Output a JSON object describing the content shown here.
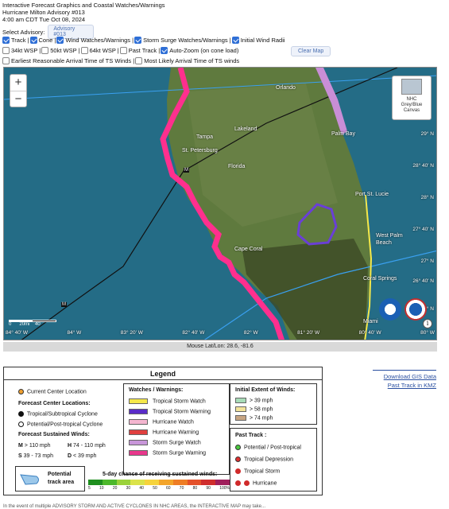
{
  "header": {
    "line1": "Interactive Forecast Graphics and Coastal Watches/Warnings",
    "line2": "Hurricane Milton Advisory #013",
    "line3": "4:00 am CDT Tue Oct 08, 2024"
  },
  "advisory": {
    "label": "Select Advisory:",
    "value": "Advisory #013"
  },
  "options_row1": [
    {
      "label": "Track |",
      "checked": true
    },
    {
      "label": "Cone |",
      "checked": true
    },
    {
      "label": "Wind Watches/Warnings |",
      "checked": true
    },
    {
      "label": "Storm Surge Watches/Warnings |",
      "checked": true
    },
    {
      "label": "Initial Wind Radii",
      "checked": true
    }
  ],
  "options_row2": [
    {
      "label": "34kt WSP |",
      "checked": false
    },
    {
      "label": "50kt WSP |",
      "checked": false
    },
    {
      "label": "64kt WSP |",
      "checked": false
    },
    {
      "label": "Past Track |",
      "checked": false
    },
    {
      "label": "Auto-Zoom (on cone load)",
      "checked": true
    }
  ],
  "options_row3": [
    {
      "label": "Earliest Reasonable Arrival Time of TS Winds |",
      "checked": false
    },
    {
      "label": "Most Likely Arrival Time of TS winds",
      "checked": false
    }
  ],
  "clear_map": "Clear Map",
  "map": {
    "zoom_in": "+",
    "zoom_out": "−",
    "basemap": {
      "line1": "NHC",
      "line2": "Grey/Blue",
      "line3": "Canvas"
    },
    "places": {
      "orlando": "Orlando",
      "tampa": "Tampa",
      "lakeland": "Lakeland",
      "stpete": "St. Petersburg",
      "florida": "Florida",
      "palmbay": "Palm Bay",
      "portstlucie": "Port St. Lucie",
      "wpb1": "West Palm",
      "wpb2": "Beach",
      "coral": "Coral Springs",
      "miami": "Miami",
      "cape": "Cape Coral"
    },
    "lat_labels": [
      "29° N",
      "28° 40' N",
      "28° N",
      "27° 40' N",
      "27° N",
      "26° 40' N",
      "26° N"
    ],
    "lon_labels": [
      "84° 40' W",
      "84° 20' W",
      "84° W",
      "83° 40' W",
      "83° 20' W",
      "83° W",
      "82° 40' W",
      "82° 20' W",
      "82° W",
      "81° 40' W",
      "81° 20' W",
      "81° W",
      "80° 40' W",
      "80° 20' W",
      "80° W",
      "79° 40' W"
    ],
    "scale_labels": [
      "0",
      "20mi",
      "40"
    ],
    "storm_marker": "M",
    "info": "i",
    "colors": {
      "surge_warning": "#ff2f8e",
      "surge_watch": "#c98ed6",
      "track": "#111111",
      "cone": "#3aa0f0",
      "ts_warning": "#6a3fd6"
    }
  },
  "mouse_readout": "Mouse Lat/Lon: 28.6, -81.6",
  "legend": {
    "title": "Legend",
    "current_center": "Current Center Location",
    "forecast_locations": "Forecast Center Locations:",
    "tropical": "Tropical/Subtropical Cyclone",
    "post_tropical": "Potential/Post-tropical Cyclone",
    "sustained_winds": "Forecast Sustained Winds:",
    "m": "M",
    "m_text": "> 110 mph",
    "h": "H",
    "h_text": "74 - 110 mph",
    "s": "S",
    "s_text": "39 - 73 mph",
    "d": "D",
    "d_text": "< 39 mph",
    "watches_title": "Watches / Warnings:",
    "watches": [
      {
        "label": "Tropical Storm Watch",
        "color": "#f5e84a"
      },
      {
        "label": "Tropical Storm Warning",
        "color": "#5a2cc8"
      },
      {
        "label": "Hurricane Watch",
        "color": "#f4b6d0"
      },
      {
        "label": "Hurricane Warning",
        "color": "#e0403f"
      },
      {
        "label": "Storm Surge Watch",
        "color": "#c896d9"
      },
      {
        "label": "Storm Surge Warning",
        "color": "#e8388c"
      }
    ],
    "initial_extent_title": "Initial Extent of Winds:",
    "initial_extent": [
      {
        "label": "> 39 mph",
        "color": "#a8dcb8"
      },
      {
        "label": "> 58 mph",
        "color": "#f2e39a"
      },
      {
        "label": "> 74 mph",
        "color": "#c7a583"
      }
    ],
    "past_track_title": "Past Track :",
    "past_track": [
      {
        "label": "Potential / Post-tropical",
        "color": "#4ac83e"
      },
      {
        "label": "Tropical Depression",
        "color": "#e03030"
      },
      {
        "label": "Tropical Storm",
        "color": "#d02a2a"
      },
      {
        "label": "Hurricane",
        "color": "#d02a2a"
      }
    ],
    "potential": "Potential",
    "track_area": "track area",
    "chance_title": "5-day chance of receiving sustained winds:",
    "chance_ticks": [
      "5",
      "10",
      "20",
      "30",
      "40",
      "50",
      "60",
      "70",
      "80",
      "90",
      "100%"
    ],
    "chance_colors": [
      "#1f8f1f",
      "#4cb82b",
      "#9ad23a",
      "#dbe34a",
      "#f6d33c",
      "#f3a42a",
      "#ee7d25",
      "#e4512a",
      "#cf2d2d",
      "#a01f5c"
    ]
  },
  "links": {
    "gis": "Download GIS Data",
    "kmz": "Past Track in KMZ"
  },
  "footer": "In the event of multiple ADVISORY STORM AND ACTIVE CYCLONES IN NHC AREAS, the INTERACTIVE MAP may take..."
}
